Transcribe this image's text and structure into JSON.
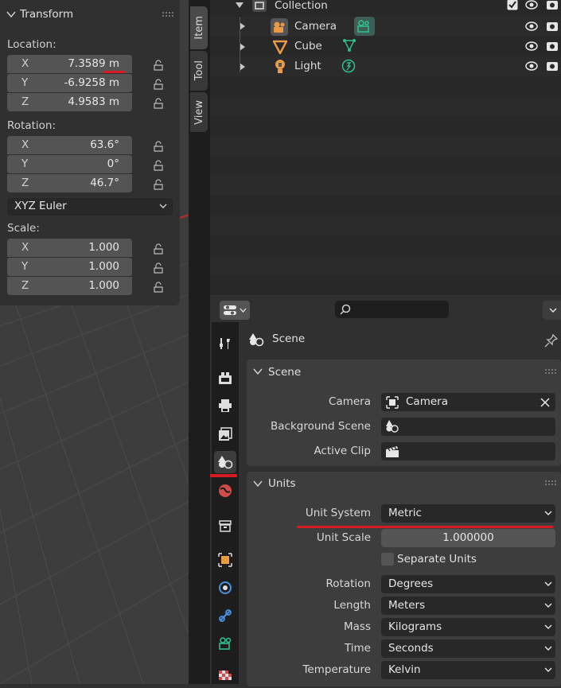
{
  "transform": {
    "title": "Transform",
    "location_label": "Location:",
    "location": [
      {
        "axis": "X",
        "value": "7.3589 m"
      },
      {
        "axis": "Y",
        "value": "-6.9258 m"
      },
      {
        "axis": "Z",
        "value": "4.9583 m"
      }
    ],
    "rotation_label": "Rotation:",
    "rotation": [
      {
        "axis": "X",
        "value": "63.6°"
      },
      {
        "axis": "Y",
        "value": "0°"
      },
      {
        "axis": "Z",
        "value": "46.7°"
      }
    ],
    "rotation_mode": "XYZ Euler",
    "scale_label": "Scale:",
    "scale": [
      {
        "axis": "X",
        "value": "1.000"
      },
      {
        "axis": "Y",
        "value": "1.000"
      },
      {
        "axis": "Z",
        "value": "1.000"
      }
    ]
  },
  "sidebar_tabs": [
    "Item",
    "Tool",
    "View"
  ],
  "outliner": {
    "collection": "Collection",
    "items": [
      {
        "name": "Camera",
        "icon": "camera-object-icon",
        "data_icon": "camera-data-icon"
      },
      {
        "name": "Cube",
        "icon": "mesh-object-icon",
        "data_icon": "mesh-data-icon"
      },
      {
        "name": "Light",
        "icon": "light-object-icon",
        "data_icon": "light-data-icon"
      }
    ]
  },
  "properties": {
    "context_title": "Scene",
    "scene_panel": {
      "title": "Scene",
      "camera_label": "Camera",
      "camera_value": "Camera",
      "background_label": "Background Scene",
      "active_clip_label": "Active Clip"
    },
    "units_panel": {
      "title": "Units",
      "unit_system_label": "Unit System",
      "unit_system_value": "Metric",
      "unit_scale_label": "Unit Scale",
      "unit_scale_value": "1.000000",
      "separate_units_label": "Separate Units",
      "rotation_label": "Rotation",
      "rotation_value": "Degrees",
      "length_label": "Length",
      "length_value": "Meters",
      "mass_label": "Mass",
      "mass_value": "Kilograms",
      "time_label": "Time",
      "time_value": "Seconds",
      "temperature_label": "Temperature",
      "temperature_value": "Kelvin"
    }
  },
  "colors": {
    "highlight_red": "#d81b22",
    "camera_green": "#2fbf8a",
    "object_orange": "#e89a46",
    "world_red": "#d24b4b",
    "blue_icon": "#4a90e2"
  }
}
